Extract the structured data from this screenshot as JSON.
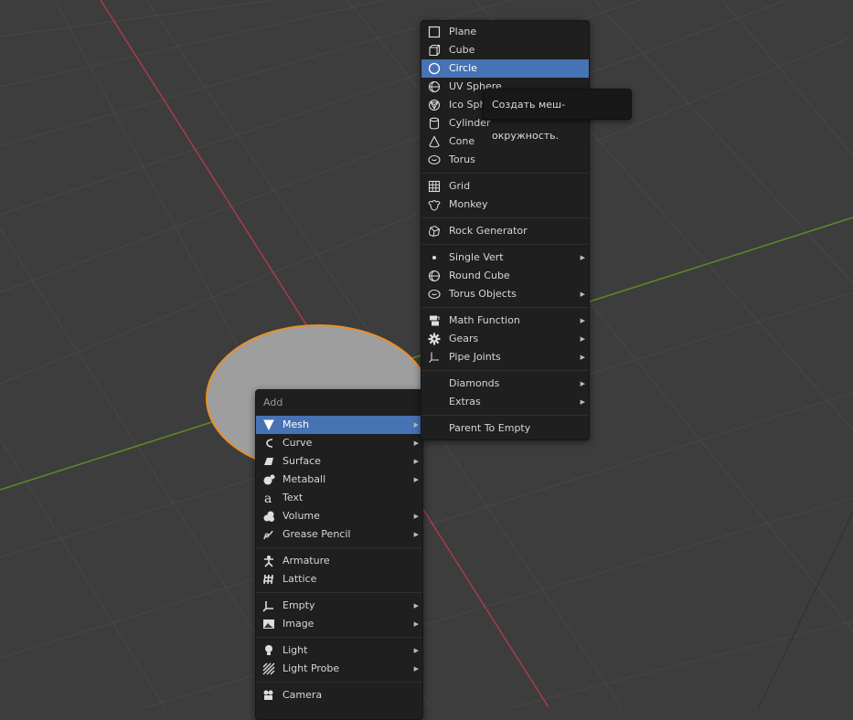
{
  "add_menu": {
    "title": "Add",
    "groups": [
      [
        {
          "label": "Mesh",
          "icon": "mesh-icon",
          "submenu": true,
          "active": true
        },
        {
          "label": "Curve",
          "icon": "curve-icon",
          "submenu": true
        },
        {
          "label": "Surface",
          "icon": "surface-icon",
          "submenu": true
        },
        {
          "label": "Metaball",
          "icon": "metaball-icon",
          "submenu": true
        },
        {
          "label": "Text",
          "icon": "text-icon",
          "submenu": false
        },
        {
          "label": "Volume",
          "icon": "volume-icon",
          "submenu": true
        },
        {
          "label": "Grease Pencil",
          "icon": "grease-pencil-icon",
          "submenu": true
        }
      ],
      [
        {
          "label": "Armature",
          "icon": "armature-icon",
          "submenu": false
        },
        {
          "label": "Lattice",
          "icon": "lattice-icon",
          "submenu": false
        }
      ],
      [
        {
          "label": "Empty",
          "icon": "empty-icon",
          "submenu": true
        },
        {
          "label": "Image",
          "icon": "image-icon",
          "submenu": true
        }
      ],
      [
        {
          "label": "Light",
          "icon": "light-icon",
          "submenu": true
        },
        {
          "label": "Light Probe",
          "icon": "light-probe-icon",
          "submenu": true
        }
      ],
      [
        {
          "label": "Camera",
          "icon": "camera-icon",
          "submenu": false
        }
      ]
    ]
  },
  "mesh_menu": {
    "groups": [
      [
        {
          "label": "Plane",
          "icon": "plane-icon",
          "submenu": false
        },
        {
          "label": "Cube",
          "icon": "cube-icon",
          "submenu": false
        },
        {
          "label": "Circle",
          "icon": "circle-icon",
          "submenu": false,
          "active": true
        },
        {
          "label": "UV Sphere",
          "icon": "uv-sphere-icon",
          "submenu": false
        },
        {
          "label": "Ico Sphere",
          "icon": "ico-sphere-icon",
          "submenu": false
        },
        {
          "label": "Cylinder",
          "icon": "cylinder-icon",
          "submenu": false
        },
        {
          "label": "Cone",
          "icon": "cone-icon",
          "submenu": false
        },
        {
          "label": "Torus",
          "icon": "torus-icon",
          "submenu": false
        }
      ],
      [
        {
          "label": "Grid",
          "icon": "grid-icon",
          "submenu": false
        },
        {
          "label": "Monkey",
          "icon": "monkey-icon",
          "submenu": false
        }
      ],
      [
        {
          "label": "Rock Generator",
          "icon": "rock-icon",
          "submenu": false
        }
      ],
      [
        {
          "label": "Single Vert",
          "icon": "vertex-dot-icon",
          "submenu": true
        },
        {
          "label": "Round Cube",
          "icon": "round-cube-icon",
          "submenu": false
        },
        {
          "label": "Torus Objects",
          "icon": "torus-icon",
          "submenu": true
        }
      ],
      [
        {
          "label": "Math Function",
          "icon": "math-function-icon",
          "submenu": true
        },
        {
          "label": "Gears",
          "icon": "gear-icon",
          "submenu": true
        },
        {
          "label": "Pipe Joints",
          "icon": "pipe-joint-icon",
          "submenu": true
        }
      ],
      [
        {
          "label": "Diamonds",
          "icon": "",
          "submenu": true
        },
        {
          "label": "Extras",
          "icon": "",
          "submenu": true
        }
      ],
      [
        {
          "label": "Parent To Empty",
          "icon": "",
          "submenu": false
        }
      ]
    ]
  },
  "tooltip": {
    "text": "Создать меш-окружность."
  },
  "colors": {
    "menu_bg": "#1f1f1f",
    "highlight": "#4772b3",
    "viewport_bg": "#3d3d3d",
    "grid_line": "#4a4a4a",
    "x_axis": "#c04050",
    "y_axis": "#6a9a2a",
    "selection_outline": "#e8902a"
  }
}
